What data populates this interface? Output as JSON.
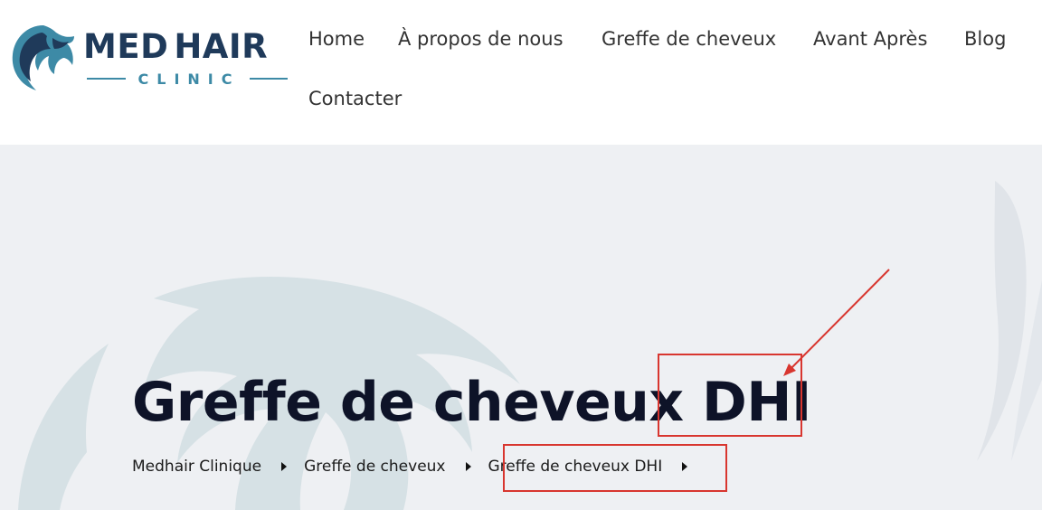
{
  "brand": {
    "name_part1": "MED",
    "name_part2": "HAIR",
    "tagline": "CLINIC",
    "colors": {
      "primary": "#1f3a5a",
      "accent": "#3d8aa6"
    }
  },
  "nav": {
    "items": [
      {
        "label": "Home"
      },
      {
        "label": "À propos de nous"
      },
      {
        "label": "Greffe de cheveux"
      },
      {
        "label": "Avant Après"
      },
      {
        "label": "Blog"
      },
      {
        "label": "Contacter"
      }
    ]
  },
  "hero": {
    "title_main": "Greffe de cheveux",
    "title_highlight": "DHI",
    "breadcrumb": [
      {
        "label": "Medhair Clinique"
      },
      {
        "label": "Greffe de cheveux"
      },
      {
        "label": "Greffe de cheveux DHI"
      }
    ]
  },
  "colors": {
    "header_bg": "#ffffff",
    "hero_bg": "#eef0f3",
    "title": "#0e1328",
    "annotation": "#d8362f"
  }
}
